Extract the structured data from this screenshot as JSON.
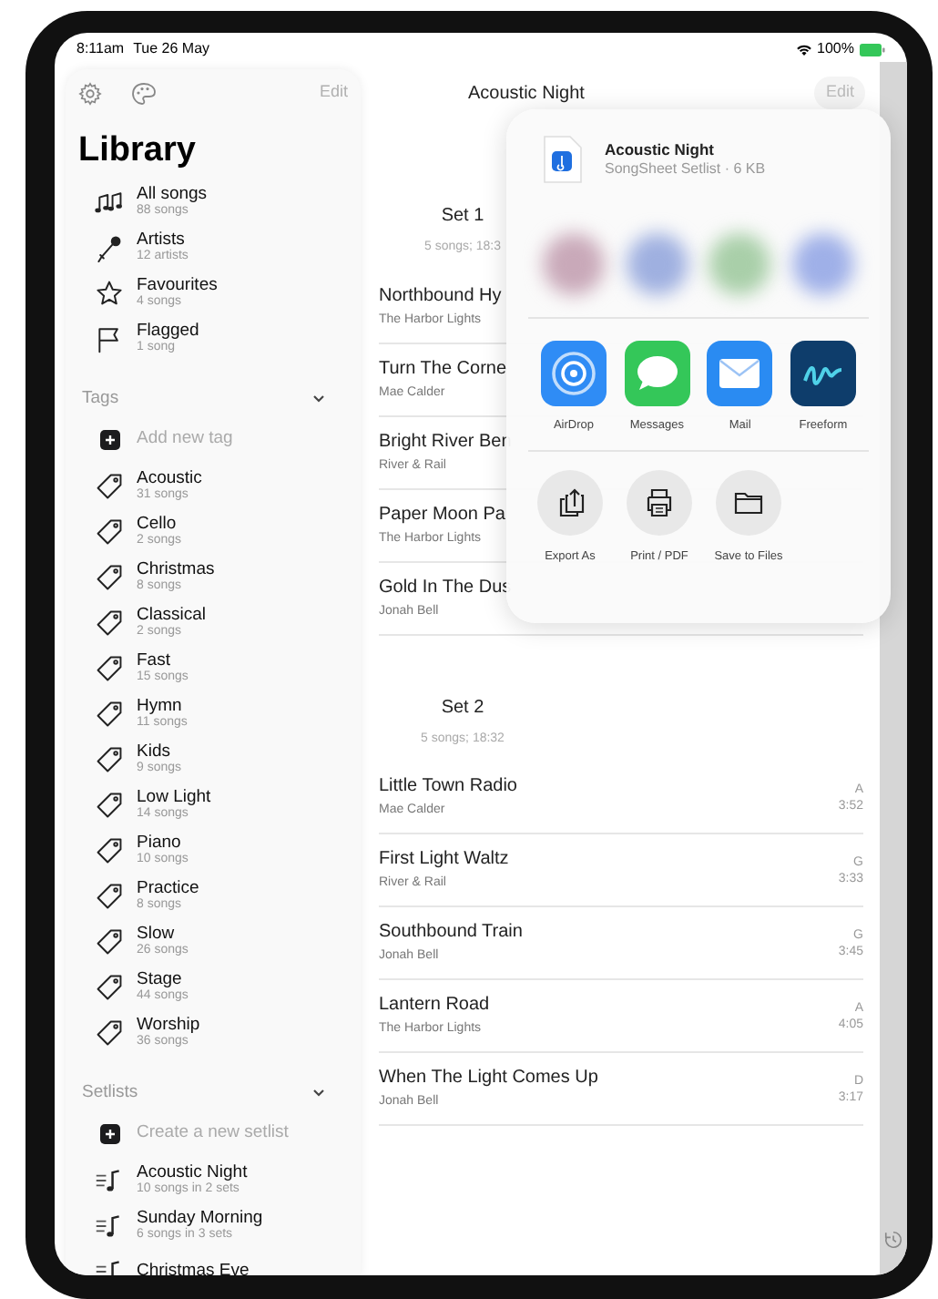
{
  "status_bar": {
    "time": "8:11am",
    "date": "Tue 26 May",
    "battery": "100%"
  },
  "sidebar": {
    "edit": "Edit",
    "title": "Library",
    "library": [
      {
        "kind": "notes",
        "label": "All songs",
        "count": "88 songs"
      },
      {
        "kind": "mic",
        "label": "Artists",
        "count": "12 artists"
      },
      {
        "kind": "star",
        "label": "Favourites",
        "count": "4 songs"
      },
      {
        "kind": "flag",
        "label": "Flagged",
        "count": "1 song"
      }
    ],
    "sections": [
      {
        "kind": "tag",
        "title": "Tags",
        "expanded": true,
        "add_label": "Add new tag",
        "items": [
          {
            "label": "Acoustic",
            "count": "31 songs"
          },
          {
            "label": "Cello",
            "count": "2 songs"
          },
          {
            "label": "Christmas",
            "count": "8 songs"
          },
          {
            "label": "Classical",
            "count": "2 songs"
          },
          {
            "label": "Fast",
            "count": "15 songs"
          },
          {
            "label": "Hymn",
            "count": "11 songs"
          },
          {
            "label": "Kids",
            "count": "9 songs"
          },
          {
            "label": "Low Light",
            "count": "14 songs"
          },
          {
            "label": "Piano",
            "count": "10 songs"
          },
          {
            "label": "Practice",
            "count": "8 songs"
          },
          {
            "label": "Slow",
            "count": "26 songs"
          },
          {
            "label": "Stage",
            "count": "44 songs"
          },
          {
            "label": "Worship",
            "count": "36 songs"
          }
        ]
      },
      {
        "kind": "setlist",
        "title": "Setlists",
        "expanded": true,
        "add_label": "Create a new setlist",
        "items": [
          {
            "label": "Acoustic Night",
            "count": "10 songs in 2 sets"
          },
          {
            "label": "Sunday Morning",
            "count": "6 songs in 3 sets"
          },
          {
            "label": "Christmas Eve"
          }
        ]
      }
    ]
  },
  "main": {
    "title": "Acoustic Night",
    "edit": "Edit",
    "sets": [
      {
        "title": "Set 1",
        "summary": "5 songs; 18:3",
        "songs": [
          {
            "title": "Northbound Hy",
            "artist": "The Harbor Lights"
          },
          {
            "title": "Turn The Corne",
            "artist": "Mae Calder"
          },
          {
            "title": "Bright River Ben",
            "artist": "River & Rail"
          },
          {
            "title": "Paper Moon Pa",
            "artist": "The Harbor Lights"
          },
          {
            "title": "Gold In The Dus",
            "artist": "Jonah Bell"
          }
        ]
      },
      {
        "title": "Set 2",
        "summary": "5 songs; 18:32",
        "songs": [
          {
            "title": "Little Town Radio",
            "artist": "Mae Calder",
            "key": "A",
            "duration": "3:52"
          },
          {
            "title": "First Light Waltz",
            "artist": "River & Rail",
            "key": "G",
            "duration": "3:33"
          },
          {
            "title": "Southbound Train",
            "artist": "Jonah Bell",
            "key": "G",
            "duration": "3:45"
          },
          {
            "title": "Lantern Road",
            "artist": "The Harbor Lights",
            "key": "A",
            "duration": "4:05"
          },
          {
            "title": "When The Light Comes Up",
            "artist": "Jonah Bell",
            "key": "D",
            "duration": "3:17"
          }
        ]
      }
    ]
  },
  "share_sheet": {
    "file_name": "Acoustic Night",
    "file_info": "SongSheet Setlist · 6 KB",
    "apps": [
      {
        "kind": "airdrop",
        "label": "AirDrop"
      },
      {
        "kind": "messages",
        "label": "Messages"
      },
      {
        "kind": "mail",
        "label": "Mail"
      },
      {
        "kind": "freeform",
        "label": "Freeform"
      }
    ],
    "actions": [
      {
        "kind": "export",
        "label": "Export As"
      },
      {
        "kind": "print",
        "label": "Print / PDF"
      },
      {
        "kind": "files",
        "label": "Save to Files"
      }
    ]
  }
}
